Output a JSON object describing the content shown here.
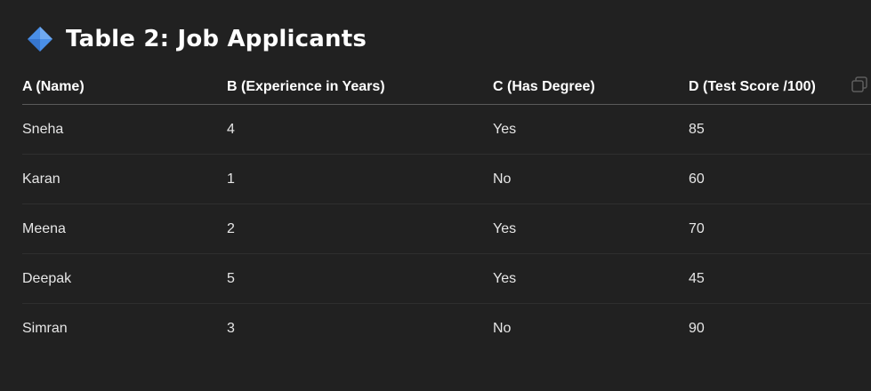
{
  "title": {
    "icon": "blue-diamond-icon",
    "text": "Table 2: Job Applicants"
  },
  "table": {
    "headers": [
      "A (Name)",
      "B (Experience in Years)",
      "C (Has Degree)",
      "D (Test Score /100)"
    ],
    "rows": [
      [
        "Sneha",
        "4",
        "Yes",
        "85"
      ],
      [
        "Karan",
        "1",
        "No",
        "60"
      ],
      [
        "Meena",
        "2",
        "Yes",
        "70"
      ],
      [
        "Deepak",
        "5",
        "Yes",
        "45"
      ],
      [
        "Simran",
        "3",
        "No",
        "90"
      ]
    ]
  },
  "colors": {
    "background": "#212121",
    "accent": "#4a8fe7"
  }
}
